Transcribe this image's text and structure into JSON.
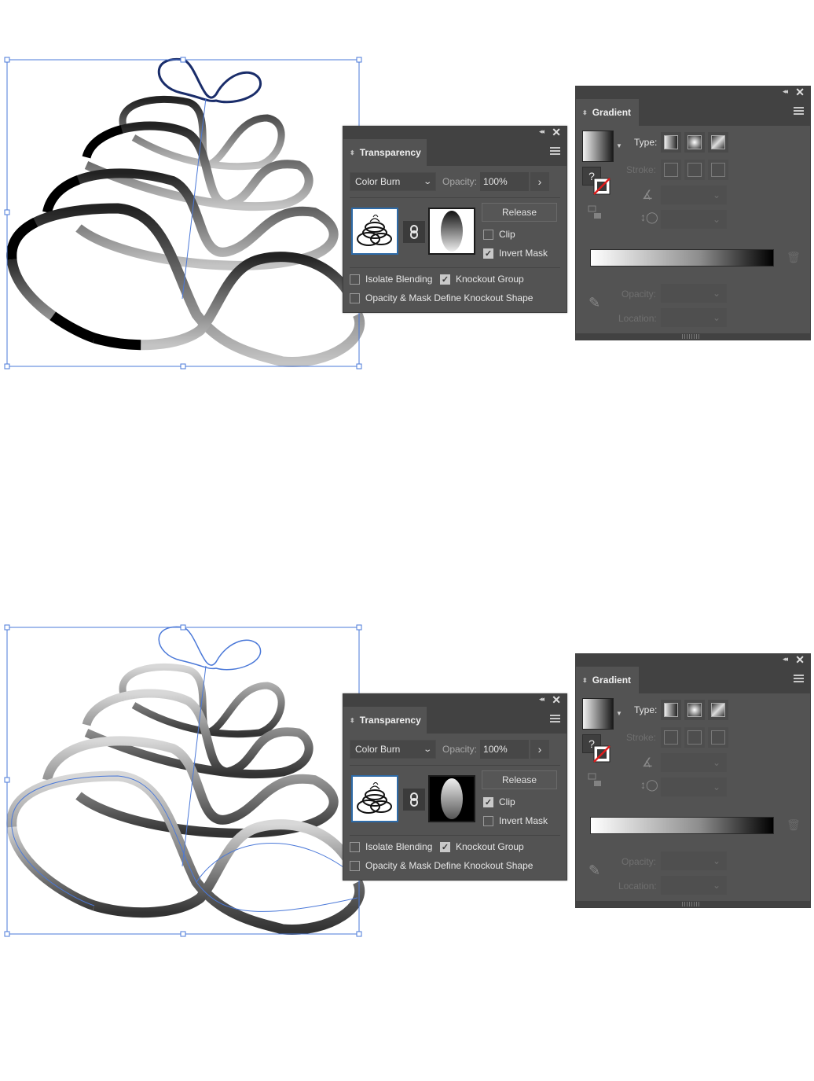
{
  "scenes": [
    {
      "transparency": {
        "title": "Transparency",
        "blend_mode": "Color Burn",
        "opacity_label": "Opacity:",
        "opacity_value": "100%",
        "release_label": "Release",
        "clip_label": "Clip",
        "clip_checked": false,
        "invert_mask_label": "Invert Mask",
        "invert_mask_checked": true,
        "isolate_blending_label": "Isolate Blending",
        "isolate_blending_checked": false,
        "knockout_group_label": "Knockout Group",
        "knockout_group_checked": true,
        "opacity_mask_knockout_label": "Opacity & Mask Define Knockout Shape",
        "opacity_mask_knockout_checked": false,
        "mask_thumbnail_background": "white"
      },
      "gradient": {
        "title": "Gradient",
        "type_label": "Type:",
        "stroke_label": "Stroke:",
        "opacity_label": "Opacity:",
        "location_label": "Location:",
        "ramp_colors": [
          "#ffffff",
          "#8c8c8c",
          "#000000"
        ]
      }
    },
    {
      "transparency": {
        "title": "Transparency",
        "blend_mode": "Color Burn",
        "opacity_label": "Opacity:",
        "opacity_value": "100%",
        "release_label": "Release",
        "clip_label": "Clip",
        "clip_checked": true,
        "invert_mask_label": "Invert Mask",
        "invert_mask_checked": false,
        "isolate_blending_label": "Isolate Blending",
        "isolate_blending_checked": false,
        "knockout_group_label": "Knockout Group",
        "knockout_group_checked": true,
        "opacity_mask_knockout_label": "Opacity & Mask Define Knockout Shape",
        "opacity_mask_knockout_checked": false,
        "mask_thumbnail_background": "black"
      },
      "gradient": {
        "title": "Gradient",
        "type_label": "Type:",
        "stroke_label": "Stroke:",
        "opacity_label": "Opacity:",
        "location_label": "Location:",
        "ramp_colors": [
          "#ffffff",
          "#8c8c8c",
          "#000000"
        ]
      }
    }
  ],
  "icons": {
    "checkmark": "✓",
    "chevron_down": "⌄",
    "chevron_right": "›",
    "close": "✕",
    "collapse": "◂◂",
    "updown": "⬍",
    "help": "?"
  },
  "colors": {
    "selection_blue": "#4a78d8",
    "panel_bg": "#535353",
    "panel_header": "#424242"
  }
}
